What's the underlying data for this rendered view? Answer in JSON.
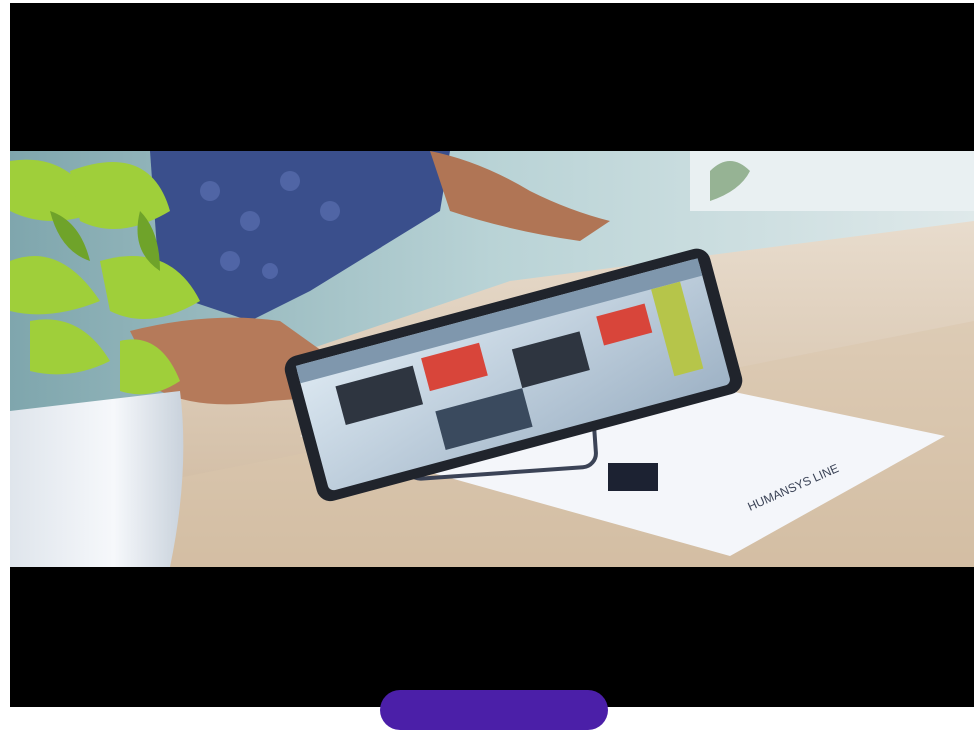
{
  "video": {
    "description_icon": "video-still"
  },
  "cta": {
    "label": "",
    "color": "#4b1fa8"
  }
}
